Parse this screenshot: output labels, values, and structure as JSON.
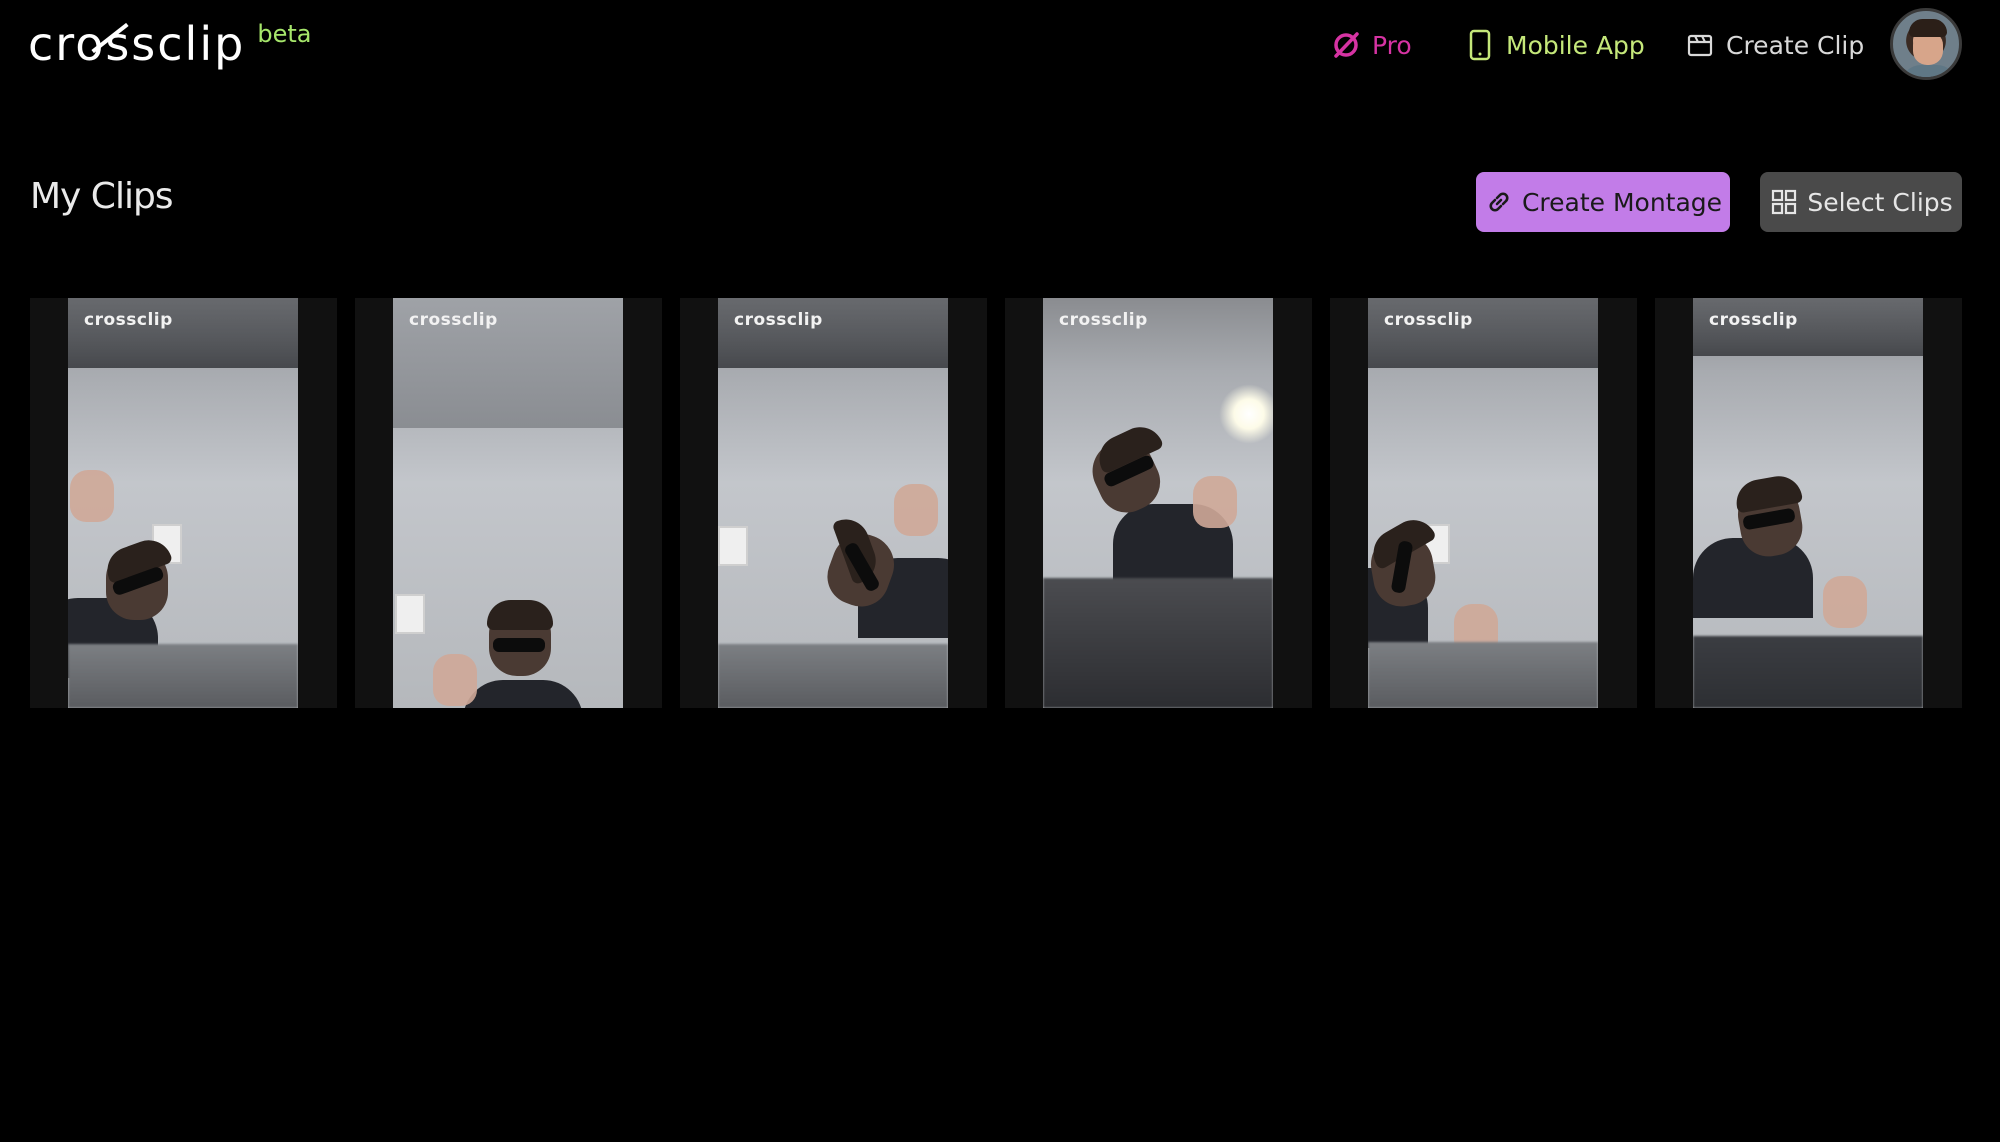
{
  "header": {
    "logo_text": "crossclip",
    "beta_label": "beta",
    "nav": {
      "pro_label": "Pro",
      "mobile_app_label": "Mobile App",
      "create_clip_label": "Create Clip"
    }
  },
  "colors": {
    "pro": "#d633a3",
    "mobile_app": "#c5e87a",
    "beta": "#a6e66b",
    "montage_button": "#c27ce8",
    "select_button": "#4a4a4a"
  },
  "main": {
    "title": "My Clips",
    "create_montage_label": "Create Montage",
    "select_clips_label": "Select Clips"
  },
  "clips": [
    {
      "watermark": "crossclip"
    },
    {
      "watermark": "crossclip"
    },
    {
      "watermark": "crossclip"
    },
    {
      "watermark": "crossclip"
    },
    {
      "watermark": "crossclip"
    },
    {
      "watermark": "crossclip"
    }
  ],
  "icons": {
    "pro": "no-sign-icon",
    "mobile_app": "phone-icon",
    "create_clip": "clapperboard-icon",
    "create_montage": "link-icon",
    "select_clips": "grid-icon"
  }
}
